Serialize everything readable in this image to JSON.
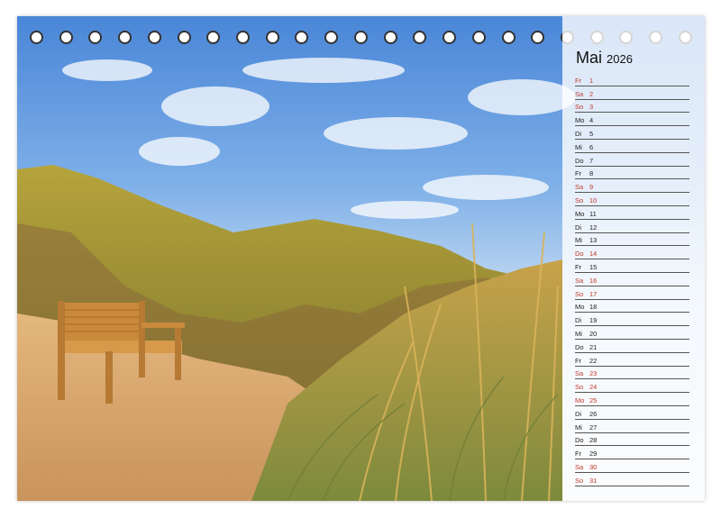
{
  "calendar": {
    "month": "Mai",
    "year": "2026",
    "days": [
      {
        "wd": "Fr",
        "d": "1",
        "red": true
      },
      {
        "wd": "Sa",
        "d": "2",
        "red": true
      },
      {
        "wd": "So",
        "d": "3",
        "red": true
      },
      {
        "wd": "Mo",
        "d": "4",
        "red": false
      },
      {
        "wd": "Di",
        "d": "5",
        "red": false
      },
      {
        "wd": "Mi",
        "d": "6",
        "red": false
      },
      {
        "wd": "Do",
        "d": "7",
        "red": false
      },
      {
        "wd": "Fr",
        "d": "8",
        "red": false
      },
      {
        "wd": "Sa",
        "d": "9",
        "red": true
      },
      {
        "wd": "So",
        "d": "10",
        "red": true
      },
      {
        "wd": "Mo",
        "d": "11",
        "red": false
      },
      {
        "wd": "Di",
        "d": "12",
        "red": false
      },
      {
        "wd": "Mi",
        "d": "13",
        "red": false
      },
      {
        "wd": "Do",
        "d": "14",
        "red": true
      },
      {
        "wd": "Fr",
        "d": "15",
        "red": false
      },
      {
        "wd": "Sa",
        "d": "16",
        "red": true
      },
      {
        "wd": "So",
        "d": "17",
        "red": true
      },
      {
        "wd": "Mo",
        "d": "18",
        "red": false
      },
      {
        "wd": "Di",
        "d": "19",
        "red": false
      },
      {
        "wd": "Mi",
        "d": "20",
        "red": false
      },
      {
        "wd": "Do",
        "d": "21",
        "red": false
      },
      {
        "wd": "Fr",
        "d": "22",
        "red": false
      },
      {
        "wd": "Sa",
        "d": "23",
        "red": true
      },
      {
        "wd": "So",
        "d": "24",
        "red": true
      },
      {
        "wd": "Mo",
        "d": "25",
        "red": true
      },
      {
        "wd": "Di",
        "d": "26",
        "red": false
      },
      {
        "wd": "Mi",
        "d": "27",
        "red": false
      },
      {
        "wd": "Do",
        "d": "28",
        "red": false
      },
      {
        "wd": "Fr",
        "d": "29",
        "red": false
      },
      {
        "wd": "Sa",
        "d": "30",
        "red": true
      },
      {
        "wd": "So",
        "d": "31",
        "red": true
      }
    ]
  },
  "colors": {
    "holiday": "#c0392b",
    "weekday": "#222222",
    "ring": "#333333"
  },
  "binding_rings": 23
}
